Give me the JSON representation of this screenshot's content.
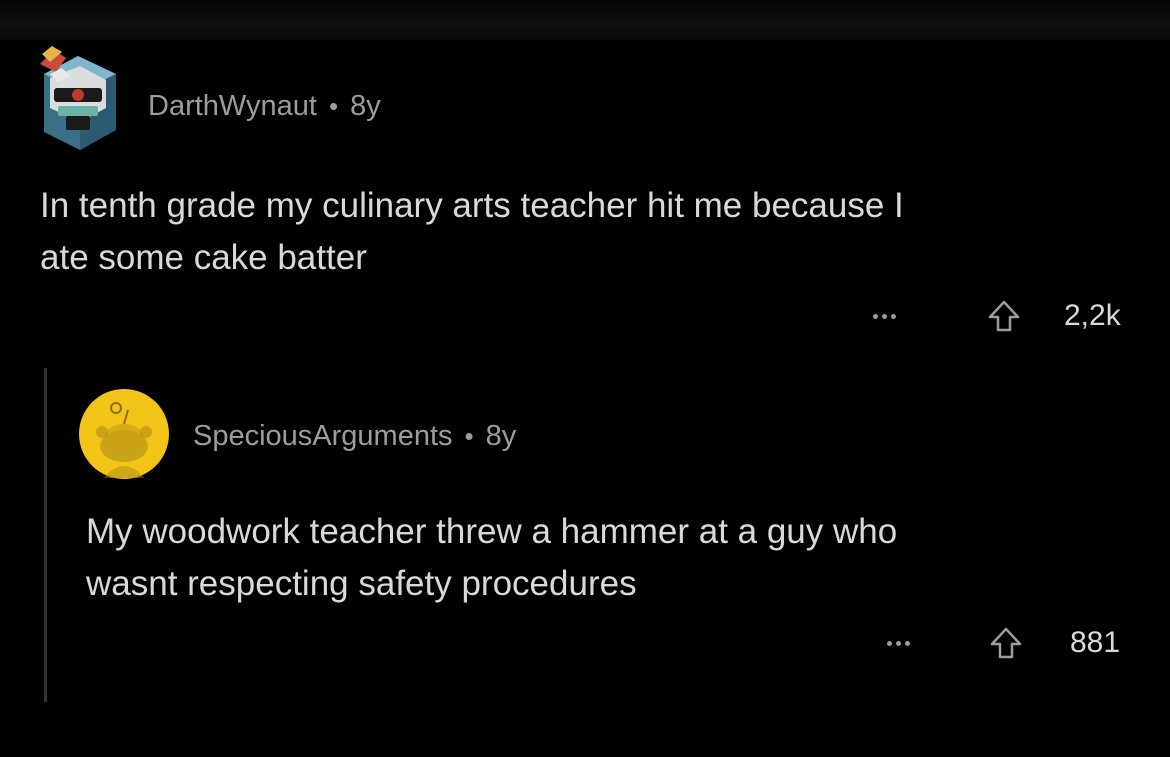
{
  "comments": [
    {
      "username": "DarthWynaut",
      "separator": "•",
      "age": "8y",
      "text_line1": "In tenth grade my culinary arts teacher hit me because I",
      "text_line2": "ate some cake batter",
      "score": "2,2k",
      "avatar_icon": "robot-avatar-icon"
    },
    {
      "username": "SpeciousArguments",
      "separator": "•",
      "age": "8y",
      "text_line1": "My woodwork teacher threw a hammer at a guy who",
      "text_line2": "wasnt respecting safety procedures",
      "score": "881",
      "avatar_icon": "snoo-avatar-icon"
    }
  ],
  "colors": {
    "background": "#000000",
    "text": "#d7dadc",
    "meta": "#9a9c9e",
    "thread_line": "#333333",
    "avatar_yellow": "#f2c417"
  }
}
